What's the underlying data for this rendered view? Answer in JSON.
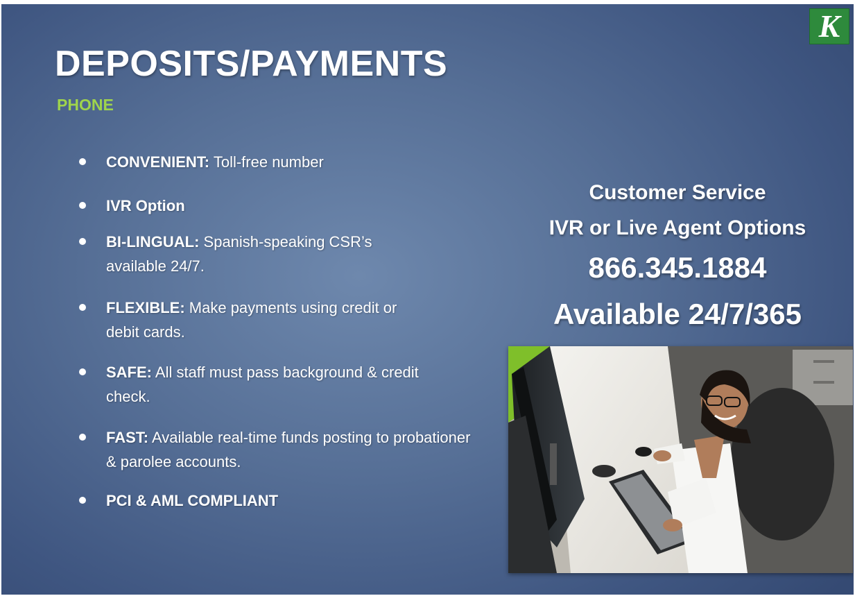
{
  "logo": {
    "letter": "K",
    "color": "#2e8a3c"
  },
  "title": "DEPOSITS/PAYMENTS",
  "subtitle": "PHONE",
  "bullets": [
    {
      "lead": "CONVENIENT:",
      "text": " Toll-free number"
    },
    {
      "lead": "IVR Option",
      "text": ""
    },
    {
      "lead": "BI-LINGUAL:",
      "text": " Spanish-speaking CSR’s available 24/7."
    },
    {
      "lead": "FLEXIBLE:",
      "text": " Make payments using credit or debit cards."
    },
    {
      "lead": "SAFE:",
      "text": " All staff must pass background & credit check."
    },
    {
      "lead": "FAST:",
      "text": "  Available real-time funds posting to probationer & parolee accounts."
    },
    {
      "lead": "PCI & AML COMPLIANT",
      "text": ""
    }
  ],
  "customer_service": {
    "heading": "Customer Service",
    "options": "IVR or Live Agent Options",
    "phone": "866.345.1884",
    "availability": "Available 24/7/365"
  },
  "colors": {
    "background": "#566f96",
    "subtitle_accent": "#9fd44c",
    "text": "#ffffff"
  }
}
